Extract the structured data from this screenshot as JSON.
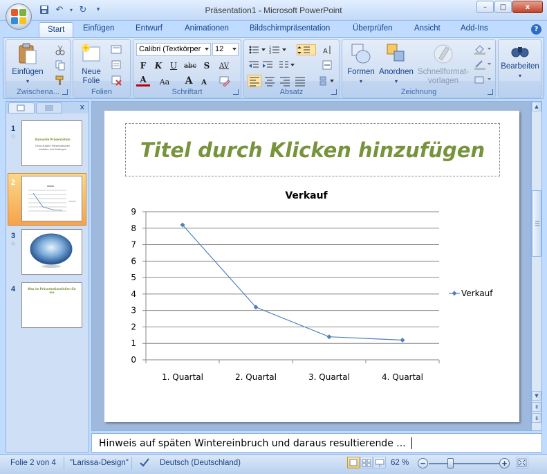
{
  "window": {
    "title": "Präsentation1 - Microsoft PowerPoint",
    "minimize_glyph": "–",
    "maximize_glyph": "□",
    "close_glyph": "x"
  },
  "tabs": [
    {
      "label": "Start",
      "active": true
    },
    {
      "label": "Einfügen"
    },
    {
      "label": "Entwurf"
    },
    {
      "label": "Animationen"
    },
    {
      "label": "Bildschirmpräsentation"
    },
    {
      "label": "Überprüfen"
    },
    {
      "label": "Ansicht"
    },
    {
      "label": "Add-Ins"
    }
  ],
  "ribbon": {
    "groups": {
      "clipboard": {
        "label": "Zwischena...",
        "paste": "Einfügen"
      },
      "slides": {
        "label": "Folien",
        "new_slide_line1": "Neue",
        "new_slide_line2": "Folie"
      },
      "font": {
        "label": "Schriftart",
        "font_name": "Calibri (Textkörper",
        "font_size": "12",
        "bold": "F",
        "italic": "K",
        "underline": "U",
        "strike": "abc",
        "shadow": "S",
        "spacing": "AV",
        "color_a": "A",
        "case": "Aa",
        "grow": "A",
        "shrink": "A"
      },
      "paragraph": {
        "label": "Absatz"
      },
      "drawing": {
        "label": "Zeichnung",
        "shapes": "Formen",
        "arrange": "Anordnen",
        "quick_styles_line1": "Schnellformat-",
        "quick_styles_line2": "vorlagen"
      },
      "editing": {
        "label": "Bearbeiten"
      }
    }
  },
  "left_pane": {
    "slides": [
      {
        "number": "1",
        "title": "Sinnvolle Präsentation",
        "subtitle": "Ohne äußere Präsentationen arbeiten und bedingen"
      },
      {
        "number": "2",
        "selected": true
      },
      {
        "number": "3"
      },
      {
        "number": "4",
        "title": "Was im Präsentationsfolien für me"
      }
    ]
  },
  "slide": {
    "title_placeholder": "Titel durch Klicken hinzufügen"
  },
  "chart_data": {
    "type": "line",
    "title": "Verkauf",
    "categories": [
      "1. Quartal",
      "2. Quartal",
      "3. Quartal",
      "4. Quartal"
    ],
    "series": [
      {
        "name": "Verkauf",
        "values": [
          8.2,
          3.2,
          1.4,
          1.2
        ]
      }
    ],
    "ylim": [
      0,
      9
    ],
    "yticks": [
      "0",
      "1",
      "2",
      "3",
      "4",
      "5",
      "6",
      "7",
      "8",
      "9"
    ],
    "grid": true,
    "legend_position": "right",
    "color": "#4f81bd"
  },
  "notes": {
    "text": "Hinweis auf späten Wintereinbruch und daraus resultierende ..."
  },
  "status": {
    "slide_info": "Folie 2 von 4",
    "theme": "\"Larissa-Design\"",
    "language": "Deutsch (Deutschland)",
    "zoom": "62 %",
    "zoom_minus": "−",
    "zoom_plus": "+"
  }
}
